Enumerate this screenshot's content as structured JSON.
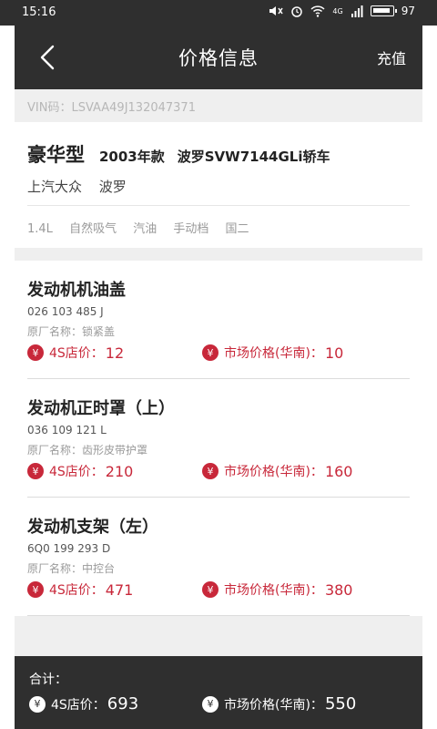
{
  "status": {
    "time": "15:16",
    "battery": "97",
    "network": "4G"
  },
  "nav": {
    "title": "价格信息",
    "action": "充值"
  },
  "vin": "VIN码：LSVAA49J132047371",
  "car": {
    "grade": "豪华型",
    "year": "2003年款",
    "model": "波罗SVW7144GLi轿车",
    "brand": "上汽大众",
    "series": "波罗",
    "specs": [
      "1.4L",
      "自然吸气",
      "汽油",
      "手动档",
      "国二"
    ]
  },
  "labels": {
    "s4": "4S店价：",
    "market": "市场价格(华南)：",
    "orig_prefix": "原厂名称：",
    "total": "合计：",
    "yen": "¥"
  },
  "parts": [
    {
      "name": "发动机机油盖",
      "code": "026 103 485 J",
      "orig": "锁紧盖",
      "s4_price": "12",
      "market_price": "10"
    },
    {
      "name": "发动机正时罩（上）",
      "code": "036 109 121 L",
      "orig": "齿形皮带护罩",
      "s4_price": "210",
      "market_price": "160"
    },
    {
      "name": "发动机支架（左）",
      "code": "6Q0 199 293 D",
      "orig": "中控台",
      "s4_price": "471",
      "market_price": "380"
    }
  ],
  "total": {
    "s4_price": "693",
    "market_price": "550"
  },
  "colors": {
    "header": "#2f2f2f",
    "accent": "#c8283a",
    "gray": "#efefef"
  }
}
